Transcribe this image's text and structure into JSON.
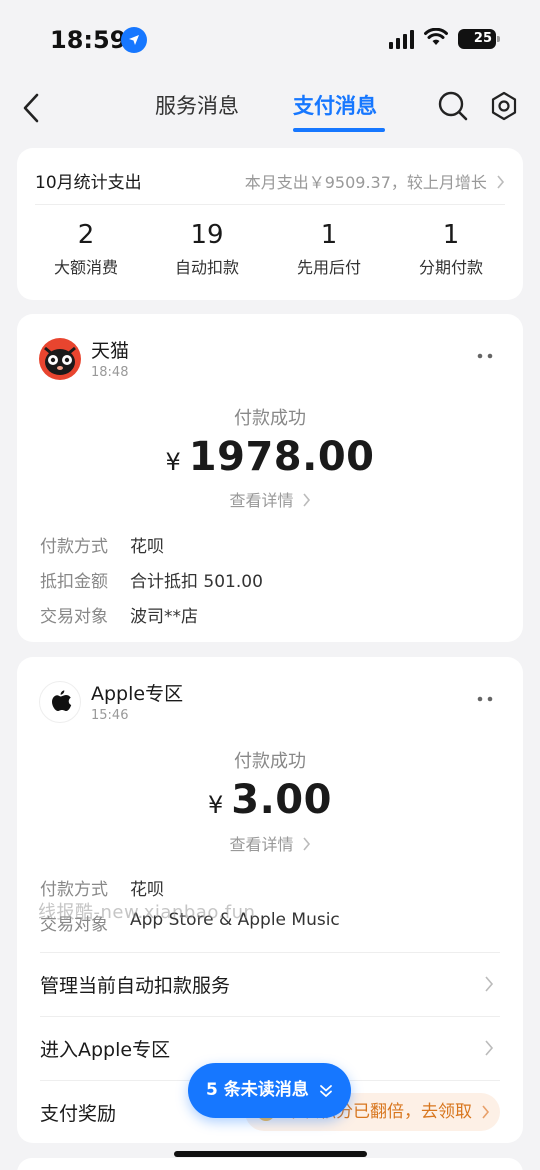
{
  "status_bar": {
    "time": "18:59",
    "battery": "25"
  },
  "nav": {
    "tabs": [
      {
        "label": "服务消息"
      },
      {
        "label": "支付消息"
      }
    ]
  },
  "summary": {
    "title": "10月统计支出",
    "link_text": "本月支出￥9509.37，较上月增长",
    "stats": [
      {
        "num": "2",
        "label": "大额消费"
      },
      {
        "num": "19",
        "label": "自动扣款"
      },
      {
        "num": "1",
        "label": "先用后付"
      },
      {
        "num": "1",
        "label": "分期付款"
      }
    ]
  },
  "payments": [
    {
      "merchant": "天猫",
      "time": "18:48",
      "status": "付款成功",
      "currency": "¥",
      "amount": "1978.00",
      "detail_link": "查看详情",
      "info": [
        {
          "label": "付款方式",
          "value": "花呗"
        },
        {
          "label": "抵扣金额",
          "value": "合计抵扣 501.00"
        },
        {
          "label": "交易对象",
          "value": "波司**店"
        }
      ]
    },
    {
      "merchant": "Apple专区",
      "time": "15:46",
      "status": "付款成功",
      "currency": "¥",
      "amount": "3.00",
      "detail_link": "查看详情",
      "info": [
        {
          "label": "付款方式",
          "value": "花呗"
        },
        {
          "label": "交易对象",
          "value": "App Store & Apple Music"
        }
      ],
      "actions": [
        {
          "label": "管理当前自动扣款服务"
        },
        {
          "label": "进入Apple专区"
        },
        {
          "label": "支付奖励",
          "extra": "本次积分已翻倍，去领取"
        }
      ]
    }
  ],
  "watermark": "线报酷-new.xianbao.fun",
  "unread_button": "5 条未读消息",
  "colors": {
    "accent": "#1677ff",
    "reward": "#d8761e"
  },
  "icons": [
    "location-arrow-icon",
    "signal-icon",
    "wifi-icon",
    "battery-icon",
    "back-arrow-icon",
    "search-icon",
    "gear-icon",
    "more-icon",
    "chevron-right-icon",
    "chevron-double-down-icon",
    "coin-icon",
    "tmall-logo",
    "apple-logo"
  ]
}
